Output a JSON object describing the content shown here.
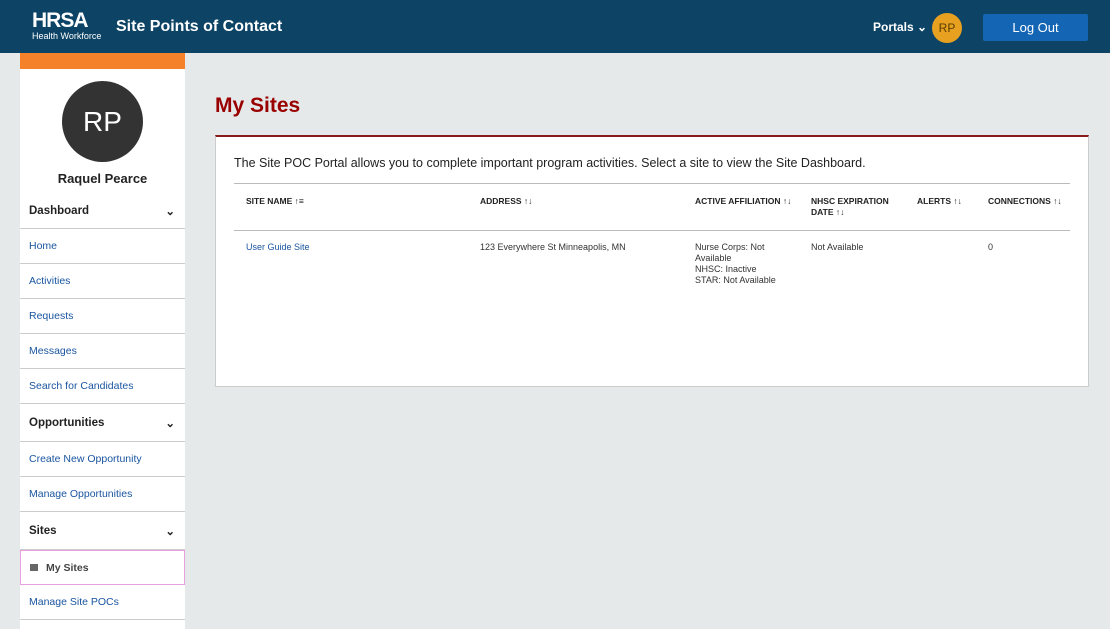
{
  "header": {
    "logo_main": "HRSA",
    "logo_sub": "Health Workforce",
    "title": "Site Points of Contact",
    "portals": "Portals",
    "avatar": "RP",
    "logout": "Log Out"
  },
  "sidebar": {
    "avatar": "RP",
    "name": "Raquel Pearce",
    "sections": [
      {
        "label": "Dashboard",
        "items": [
          "Home",
          "Activities",
          "Requests",
          "Messages",
          "Search for Candidates"
        ]
      },
      {
        "label": "Opportunities",
        "items": [
          "Create New Opportunity",
          "Manage Opportunities"
        ]
      },
      {
        "label": "Sites",
        "items": [
          "My Sites",
          "Manage Site POCs"
        ]
      }
    ],
    "active": "My Sites"
  },
  "main": {
    "title": "My Sites",
    "intro": "The Site POC Portal allows you to complete important program activities. Select a site to view the Site Dashboard.",
    "columns": [
      "SITE NAME ↑≡",
      "ADDRESS ↑↓",
      "ACTIVE AFFILIATION ↑↓",
      "NHSC EXPIRATION DATE ↑↓",
      "ALERTS ↑↓",
      "CONNECTIONS ↑↓"
    ],
    "rows": [
      {
        "site": "User Guide Site",
        "address": "123 Everywhere St Minneapolis, MN",
        "affiliation": [
          "Nurse Corps: Not Available",
          "NHSC: Inactive",
          "STAR: Not Available"
        ],
        "expiration": "Not Available",
        "alerts": "",
        "connections": "0"
      }
    ]
  }
}
